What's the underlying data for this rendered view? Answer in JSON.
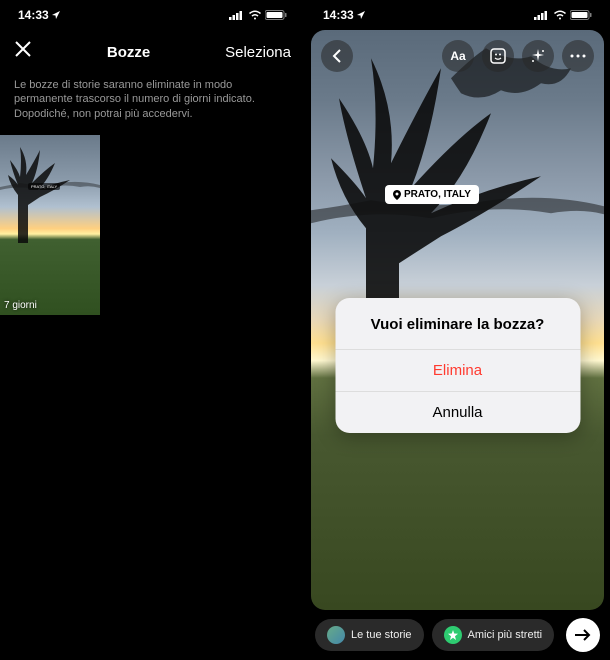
{
  "status": {
    "time": "14:33"
  },
  "left": {
    "title": "Bozze",
    "selectLabel": "Seleziona",
    "description": "Le bozze di storie saranno eliminate in modo permanente trascorso il numero di giorni indicato. Dopodiché, non potrai più accedervi.",
    "thumb": {
      "locationTag": "PRATO, ITALY",
      "daysLabel": "7 giorni"
    }
  },
  "right": {
    "textToolLabel": "Aa",
    "locationTag": "PRATO, ITALY",
    "dialog": {
      "title": "Vuoi eliminare la bozza?",
      "deleteLabel": "Elimina",
      "cancelLabel": "Annulla"
    },
    "bottom": {
      "yourStories": "Le tue storie",
      "closeFriends": "Amici più stretti"
    }
  }
}
